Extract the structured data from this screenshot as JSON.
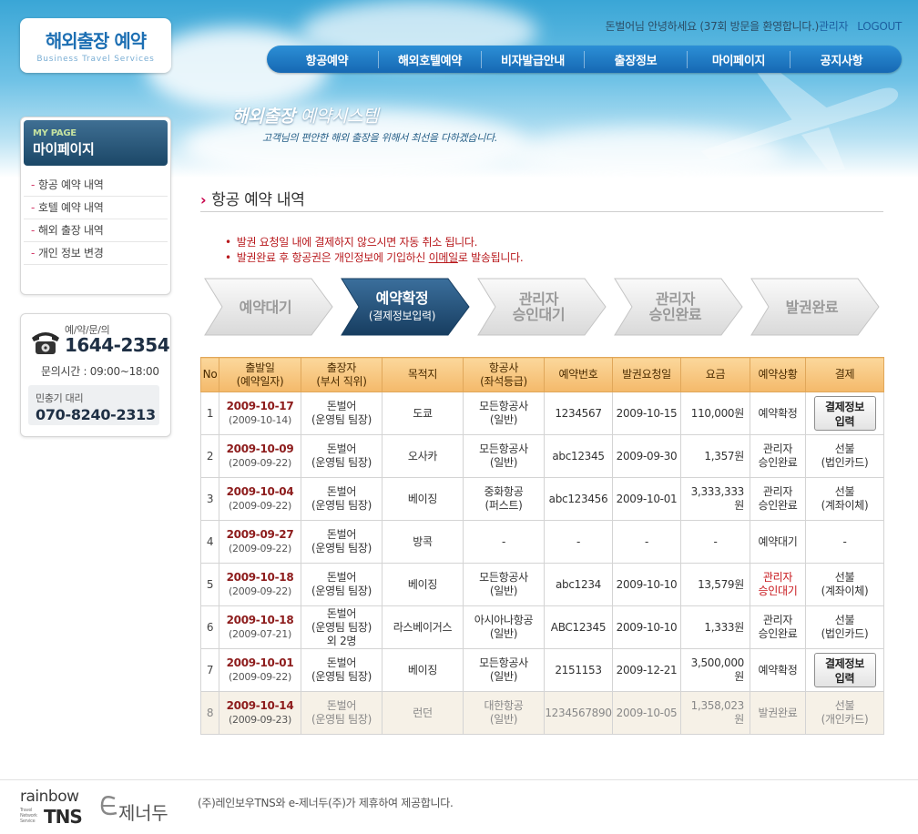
{
  "logo": {
    "title": "해외출장 예약",
    "subtitle": "Business Travel Services"
  },
  "util": {
    "greeting": "돈벌어님 안녕하세요 (37회 방문을 환영합니다.)",
    "admin": "관리자",
    "logout": "LOGOUT"
  },
  "gnb": [
    "항공예약",
    "해외호텔예약",
    "비자발급안내",
    "출장정보",
    "마이페이지",
    "공지사항"
  ],
  "slogan": {
    "title_bold": "해외출장",
    "title_rest": " 예약시스템",
    "sub": "고객님의 편안한 해외 출장을 위해서 최선을 다하겠습니다."
  },
  "sidebar": {
    "en": "MY PAGE",
    "ko": "마이페이지",
    "items": [
      {
        "label": "항공 예약 내역"
      },
      {
        "label": "호텔 예약 내역"
      },
      {
        "label": "해외 출장 내역"
      },
      {
        "label": "개인 정보 변경"
      }
    ]
  },
  "contact": {
    "label": "예/약/문/의",
    "number": "1644-2354",
    "hours": "문의시간 : 09:00~18:00",
    "agent_label": "민충기 대리",
    "agent_number": "070-8240-2313"
  },
  "section_title": "항공 예약 내역",
  "notices": [
    {
      "before": "발권 요청일 내에 결제하지 않으시면 자동 취소 됩니다.",
      "link": "",
      "after": ""
    },
    {
      "before": "발권완료 후 항공권은 개인정보에 기입하신 ",
      "link": "이메일",
      "after": "로 발송됩니다."
    }
  ],
  "steps": [
    {
      "line1": "예약대기",
      "line2": "",
      "sub": "",
      "active": false
    },
    {
      "line1": "예약확정",
      "line2": "",
      "sub": "(결제정보입력)",
      "active": true
    },
    {
      "line1": "관리자",
      "line2": "승인대기",
      "sub": "",
      "active": false
    },
    {
      "line1": "관리자",
      "line2": "승인완료",
      "sub": "",
      "active": false
    },
    {
      "line1": "발권완료",
      "line2": "",
      "sub": "",
      "active": false
    }
  ],
  "table": {
    "headers": [
      {
        "l1": "No",
        "l2": ""
      },
      {
        "l1": "출발일",
        "l2": "(예약일자)"
      },
      {
        "l1": "출장자",
        "l2": "(부서 직위)"
      },
      {
        "l1": "목적지",
        "l2": ""
      },
      {
        "l1": "항공사",
        "l2": "(좌석등급)"
      },
      {
        "l1": "예약번호",
        "l2": ""
      },
      {
        "l1": "발권요청일",
        "l2": ""
      },
      {
        "l1": "요금",
        "l2": ""
      },
      {
        "l1": "예약상황",
        "l2": ""
      },
      {
        "l1": "결제",
        "l2": ""
      }
    ],
    "rows": [
      {
        "no": "1",
        "dep": "2009-10-17",
        "res": "(2009-10-14)",
        "trav": [
          "돈벌어",
          "(운영팀 팀장)"
        ],
        "dest": "도쿄",
        "air": [
          "모든항공사",
          "(일반)"
        ],
        "rno": "1234567",
        "req": "2009-10-15",
        "fee": "110,000원",
        "status": [
          "예약확정"
        ],
        "status_red": false,
        "pay_btn": [
          "결제정보",
          "입력"
        ],
        "pay": [],
        "done": false
      },
      {
        "no": "2",
        "dep": "2009-10-09",
        "res": "(2009-09-22)",
        "trav": [
          "돈벌어",
          "(운영팀 팀장)"
        ],
        "dest": "오사카",
        "air": [
          "모든항공사",
          "(일반)"
        ],
        "rno": "abc12345",
        "req": "2009-09-30",
        "fee": "1,357원",
        "status": [
          "관리자",
          "승인완료"
        ],
        "status_red": false,
        "pay_btn": [],
        "pay": [
          "선불",
          "(법인카드)"
        ],
        "done": false
      },
      {
        "no": "3",
        "dep": "2009-10-04",
        "res": "(2009-09-22)",
        "trav": [
          "돈벌어",
          "(운영팀 팀장)"
        ],
        "dest": "베이징",
        "air": [
          "중화항공",
          "(퍼스트)"
        ],
        "rno": "abc123456",
        "req": "2009-10-01",
        "fee": "3,333,333원",
        "status": [
          "관리자",
          "승인완료"
        ],
        "status_red": false,
        "pay_btn": [],
        "pay": [
          "선불",
          "(계좌이체)"
        ],
        "done": false
      },
      {
        "no": "4",
        "dep": "2009-09-27",
        "res": "(2009-09-22)",
        "trav": [
          "돈벌어",
          "(운영팀 팀장)"
        ],
        "dest": "방콕",
        "air": [
          "-"
        ],
        "rno": "-",
        "req": "-",
        "fee": "-",
        "status": [
          "예약대기"
        ],
        "status_red": false,
        "pay_btn": [],
        "pay": [
          "-"
        ],
        "done": false
      },
      {
        "no": "5",
        "dep": "2009-10-18",
        "res": "(2009-09-22)",
        "trav": [
          "돈벌어",
          "(운영팀 팀장)"
        ],
        "dest": "베이징",
        "air": [
          "모든항공사",
          "(일반)"
        ],
        "rno": "abc1234",
        "req": "2009-10-10",
        "fee": "13,579원",
        "status": [
          "관리자",
          "승인대기"
        ],
        "status_red": true,
        "pay_btn": [],
        "pay": [
          "선불",
          "(계좌이체)"
        ],
        "done": false
      },
      {
        "no": "6",
        "dep": "2009-10-18",
        "res": "(2009-07-21)",
        "trav": [
          "돈벌어",
          "(운영팀 팀장)",
          "외 2명"
        ],
        "dest": "라스베이거스",
        "air": [
          "아시아나항공",
          "(일반)"
        ],
        "rno": "ABC12345",
        "req": "2009-10-10",
        "fee": "1,333원",
        "status": [
          "관리자",
          "승인완료"
        ],
        "status_red": false,
        "pay_btn": [],
        "pay": [
          "선불",
          "(법인카드)"
        ],
        "done": false
      },
      {
        "no": "7",
        "dep": "2009-10-01",
        "res": "(2009-09-22)",
        "trav": [
          "돈벌어",
          "(운영팀 팀장)"
        ],
        "dest": "베이징",
        "air": [
          "모든항공사",
          "(일반)"
        ],
        "rno": "2151153",
        "req": "2009-12-21",
        "fee": "3,500,000원",
        "status": [
          "예약확정"
        ],
        "status_red": false,
        "pay_btn": [
          "결제정보",
          "입력"
        ],
        "pay": [],
        "done": false
      },
      {
        "no": "8",
        "dep": "2009-10-14",
        "res": "(2009-09-23)",
        "trav": [
          "돈벌어",
          "(운영팀 팀장)"
        ],
        "dest": "런던",
        "air": [
          "대한항공",
          "(일반)"
        ],
        "rno": "1234567890",
        "req": "2009-10-05",
        "fee": "1,358,023원",
        "status": [
          "발권완료"
        ],
        "status_red": false,
        "pay_btn": [],
        "pay": [
          "선불",
          "(개인카드)"
        ],
        "done": true
      }
    ]
  },
  "footer": {
    "rainbow": "rainbow",
    "tns": "TNS",
    "tiny": "Travel Network Service",
    "gen": "제너두",
    "text": "(주)레인보우TNS와 e-제너두(주)가 제휴하여 제공합니다."
  },
  "colors": {
    "nav": "#1668b3",
    "notice": "#b8191d",
    "date": "#8d1c1c",
    "header": "#f4b96a",
    "step_active": "#1f4d77"
  },
  "icons": [
    "phone-icon",
    "airplane-icon",
    "cloud-icon",
    "arrow-icon"
  ]
}
